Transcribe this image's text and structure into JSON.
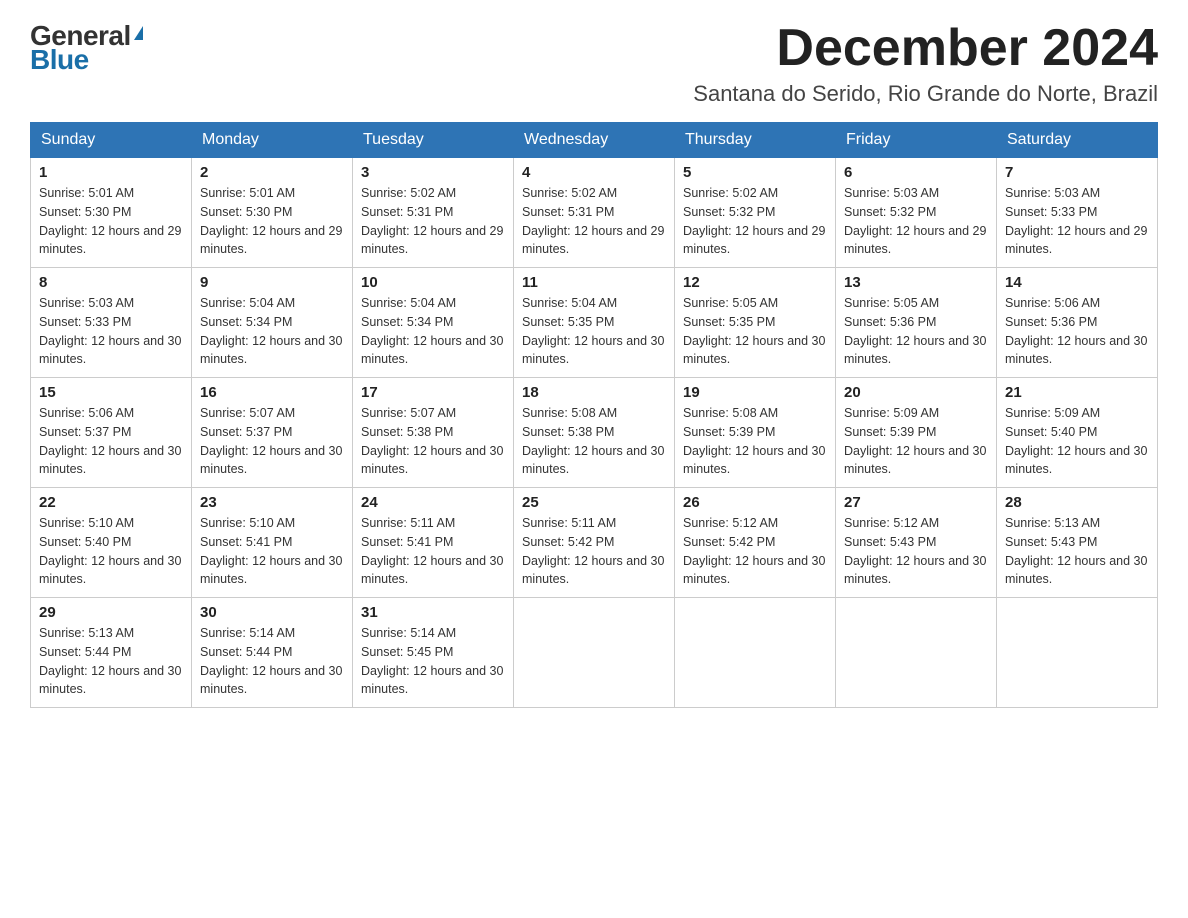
{
  "logo": {
    "general": "General",
    "blue": "Blue",
    "line1": "General",
    "line2": "Blue"
  },
  "header": {
    "title": "December 2024",
    "subtitle": "Santana do Serido, Rio Grande do Norte, Brazil"
  },
  "weekdays": [
    "Sunday",
    "Monday",
    "Tuesday",
    "Wednesday",
    "Thursday",
    "Friday",
    "Saturday"
  ],
  "weeks": [
    [
      {
        "day": "1",
        "sunrise": "5:01 AM",
        "sunset": "5:30 PM",
        "daylight": "12 hours and 29 minutes."
      },
      {
        "day": "2",
        "sunrise": "5:01 AM",
        "sunset": "5:30 PM",
        "daylight": "12 hours and 29 minutes."
      },
      {
        "day": "3",
        "sunrise": "5:02 AM",
        "sunset": "5:31 PM",
        "daylight": "12 hours and 29 minutes."
      },
      {
        "day": "4",
        "sunrise": "5:02 AM",
        "sunset": "5:31 PM",
        "daylight": "12 hours and 29 minutes."
      },
      {
        "day": "5",
        "sunrise": "5:02 AM",
        "sunset": "5:32 PM",
        "daylight": "12 hours and 29 minutes."
      },
      {
        "day": "6",
        "sunrise": "5:03 AM",
        "sunset": "5:32 PM",
        "daylight": "12 hours and 29 minutes."
      },
      {
        "day": "7",
        "sunrise": "5:03 AM",
        "sunset": "5:33 PM",
        "daylight": "12 hours and 29 minutes."
      }
    ],
    [
      {
        "day": "8",
        "sunrise": "5:03 AM",
        "sunset": "5:33 PM",
        "daylight": "12 hours and 30 minutes."
      },
      {
        "day": "9",
        "sunrise": "5:04 AM",
        "sunset": "5:34 PM",
        "daylight": "12 hours and 30 minutes."
      },
      {
        "day": "10",
        "sunrise": "5:04 AM",
        "sunset": "5:34 PM",
        "daylight": "12 hours and 30 minutes."
      },
      {
        "day": "11",
        "sunrise": "5:04 AM",
        "sunset": "5:35 PM",
        "daylight": "12 hours and 30 minutes."
      },
      {
        "day": "12",
        "sunrise": "5:05 AM",
        "sunset": "5:35 PM",
        "daylight": "12 hours and 30 minutes."
      },
      {
        "day": "13",
        "sunrise": "5:05 AM",
        "sunset": "5:36 PM",
        "daylight": "12 hours and 30 minutes."
      },
      {
        "day": "14",
        "sunrise": "5:06 AM",
        "sunset": "5:36 PM",
        "daylight": "12 hours and 30 minutes."
      }
    ],
    [
      {
        "day": "15",
        "sunrise": "5:06 AM",
        "sunset": "5:37 PM",
        "daylight": "12 hours and 30 minutes."
      },
      {
        "day": "16",
        "sunrise": "5:07 AM",
        "sunset": "5:37 PM",
        "daylight": "12 hours and 30 minutes."
      },
      {
        "day": "17",
        "sunrise": "5:07 AM",
        "sunset": "5:38 PM",
        "daylight": "12 hours and 30 minutes."
      },
      {
        "day": "18",
        "sunrise": "5:08 AM",
        "sunset": "5:38 PM",
        "daylight": "12 hours and 30 minutes."
      },
      {
        "day": "19",
        "sunrise": "5:08 AM",
        "sunset": "5:39 PM",
        "daylight": "12 hours and 30 minutes."
      },
      {
        "day": "20",
        "sunrise": "5:09 AM",
        "sunset": "5:39 PM",
        "daylight": "12 hours and 30 minutes."
      },
      {
        "day": "21",
        "sunrise": "5:09 AM",
        "sunset": "5:40 PM",
        "daylight": "12 hours and 30 minutes."
      }
    ],
    [
      {
        "day": "22",
        "sunrise": "5:10 AM",
        "sunset": "5:40 PM",
        "daylight": "12 hours and 30 minutes."
      },
      {
        "day": "23",
        "sunrise": "5:10 AM",
        "sunset": "5:41 PM",
        "daylight": "12 hours and 30 minutes."
      },
      {
        "day": "24",
        "sunrise": "5:11 AM",
        "sunset": "5:41 PM",
        "daylight": "12 hours and 30 minutes."
      },
      {
        "day": "25",
        "sunrise": "5:11 AM",
        "sunset": "5:42 PM",
        "daylight": "12 hours and 30 minutes."
      },
      {
        "day": "26",
        "sunrise": "5:12 AM",
        "sunset": "5:42 PM",
        "daylight": "12 hours and 30 minutes."
      },
      {
        "day": "27",
        "sunrise": "5:12 AM",
        "sunset": "5:43 PM",
        "daylight": "12 hours and 30 minutes."
      },
      {
        "day": "28",
        "sunrise": "5:13 AM",
        "sunset": "5:43 PM",
        "daylight": "12 hours and 30 minutes."
      }
    ],
    [
      {
        "day": "29",
        "sunrise": "5:13 AM",
        "sunset": "5:44 PM",
        "daylight": "12 hours and 30 minutes."
      },
      {
        "day": "30",
        "sunrise": "5:14 AM",
        "sunset": "5:44 PM",
        "daylight": "12 hours and 30 minutes."
      },
      {
        "day": "31",
        "sunrise": "5:14 AM",
        "sunset": "5:45 PM",
        "daylight": "12 hours and 30 minutes."
      },
      null,
      null,
      null,
      null
    ]
  ],
  "colors": {
    "header_bg": "#2e74b5",
    "header_text": "#ffffff",
    "accent_blue": "#1a6fa8"
  }
}
